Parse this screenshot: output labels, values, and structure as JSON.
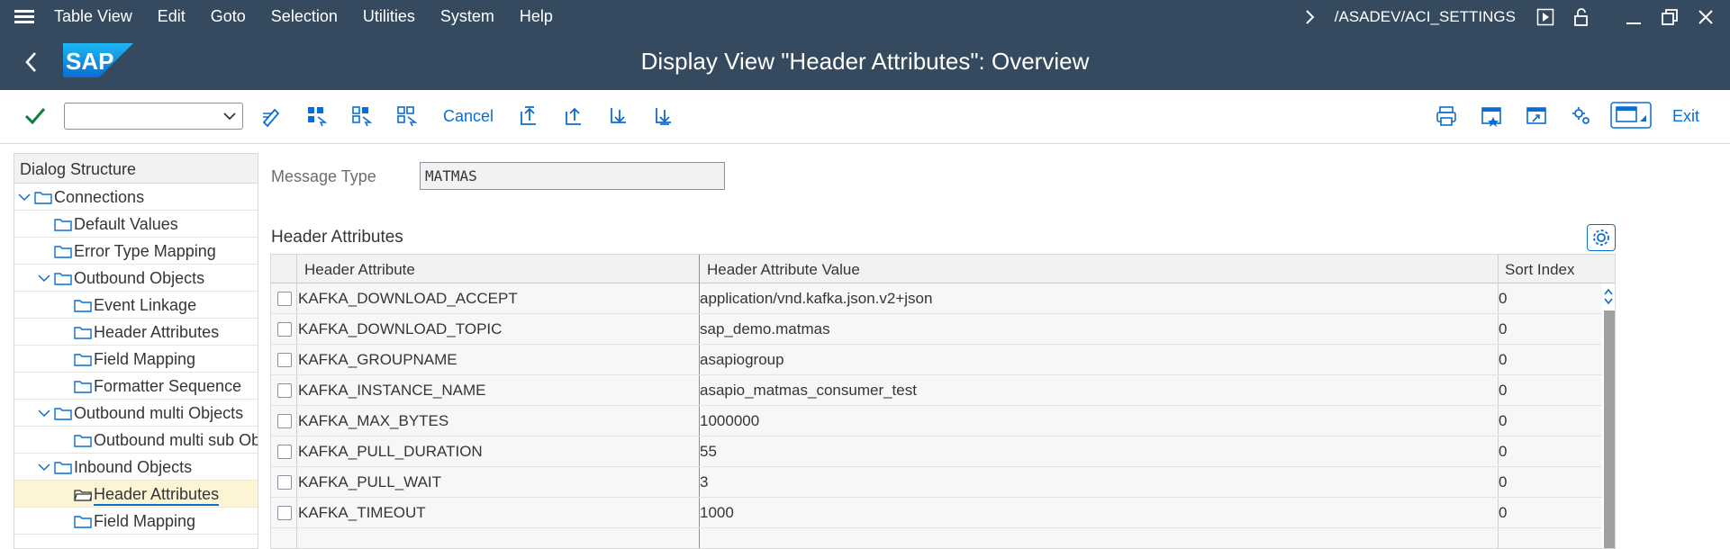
{
  "menubar": {
    "items": [
      "Table View",
      "Edit",
      "Goto",
      "Selection",
      "Utilities",
      "System",
      "Help"
    ],
    "transaction_path": "/ASADEV/ACI_SETTINGS"
  },
  "title": {
    "logo_text": "SAP",
    "page_title": "Display View \"Header Attributes\": Overview"
  },
  "toolbar": {
    "command_value": "",
    "cancel_label": "Cancel",
    "exit_label": "Exit"
  },
  "dialog_structure": {
    "header": "Dialog Structure",
    "items": [
      {
        "label": "Connections",
        "level": 0,
        "expanded": true
      },
      {
        "label": "Default Values",
        "level": 1
      },
      {
        "label": "Error Type Mapping",
        "level": 1
      },
      {
        "label": "Outbound  Objects",
        "level": 1,
        "expanded": true
      },
      {
        "label": "Event Linkage",
        "level": 2
      },
      {
        "label": "Header Attributes",
        "level": 2
      },
      {
        "label": "Field Mapping",
        "level": 2
      },
      {
        "label": "Formatter Sequence",
        "level": 2
      },
      {
        "label": "Outbound multi Objects",
        "level": 1,
        "expanded": true
      },
      {
        "label": "Outbound multi sub Ob",
        "level": 2
      },
      {
        "label": "Inbound Objects",
        "level": 1,
        "expanded": true
      },
      {
        "label": "Header Attributes",
        "level": 2,
        "selected": true
      },
      {
        "label": "Field Mapping",
        "level": 2
      }
    ]
  },
  "form": {
    "message_type_label": "Message Type",
    "message_type_value": "MATMAS"
  },
  "table": {
    "section_title": "Header Attributes",
    "columns": [
      "Header Attribute",
      "Header Attribute Value",
      "Sort Index"
    ],
    "rows": [
      {
        "attribute": "KAFKA_DOWNLOAD_ACCEPT",
        "value": "application/vnd.kafka.json.v2+json",
        "sort_index": "0"
      },
      {
        "attribute": "KAFKA_DOWNLOAD_TOPIC",
        "value": "sap_demo.matmas",
        "sort_index": "0"
      },
      {
        "attribute": "KAFKA_GROUPNAME",
        "value": "asapiogroup",
        "sort_index": "0"
      },
      {
        "attribute": "KAFKA_INSTANCE_NAME",
        "value": "asapio_matmas_consumer_test",
        "sort_index": "0"
      },
      {
        "attribute": "KAFKA_MAX_BYTES",
        "value": "1000000",
        "sort_index": "0"
      },
      {
        "attribute": "KAFKA_PULL_DURATION",
        "value": "55",
        "sort_index": "0"
      },
      {
        "attribute": "KAFKA_PULL_WAIT",
        "value": "3",
        "sort_index": "0"
      },
      {
        "attribute": "KAFKA_TIMEOUT",
        "value": "1000",
        "sort_index": "0"
      }
    ]
  },
  "colors": {
    "shell": "#354a5f",
    "accent": "#0a6ed1",
    "confirm": "#107e3e",
    "selected_row": "#fcf4d2"
  }
}
